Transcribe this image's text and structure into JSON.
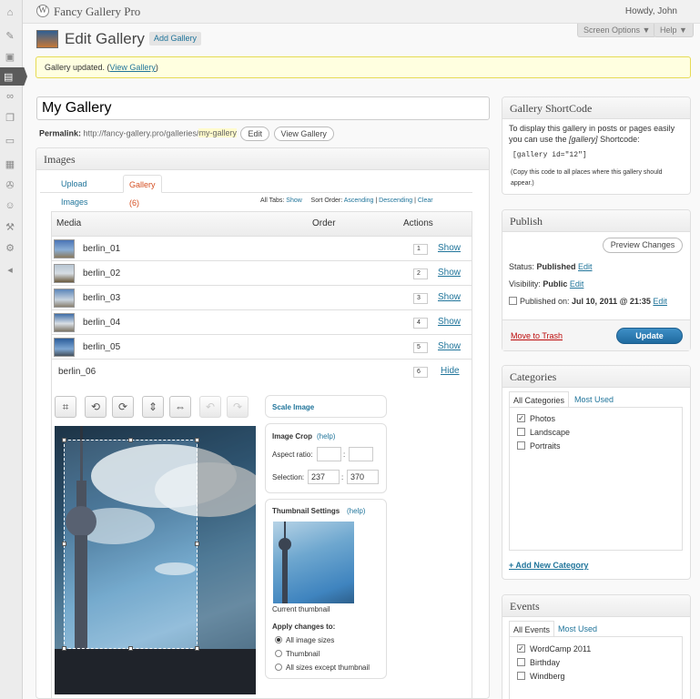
{
  "header": {
    "site_name": "Fancy Gallery Pro",
    "greeting": "Howdy, John",
    "wp_logo": "W"
  },
  "page": {
    "title": "Edit Gallery",
    "add_button": "Add Gallery",
    "screen_options": "Screen Options ▼",
    "help": "Help ▼"
  },
  "notice": {
    "text": "Gallery updated. (",
    "link": "View Gallery",
    "close": ")"
  },
  "gallery": {
    "title": "My Gallery",
    "permalink_label": "Permalink:",
    "permalink_base": "http://fancy-gallery.pro/galleries/",
    "permalink_slug": "my-gallery",
    "edit_button": "Edit",
    "view_button": "View Gallery"
  },
  "images_box": {
    "title": "Images",
    "tabs": [
      {
        "label": "Upload Images"
      },
      {
        "label": "Gallery (6)"
      }
    ],
    "sort": {
      "all_tabs": "All Tabs:",
      "show": "Show",
      "sort_order": "Sort Order:",
      "ascending": "Ascending",
      "sep1": "|",
      "descending": "Descending",
      "sep2": "|",
      "clear": "Clear"
    },
    "columns": {
      "media": "Media",
      "order": "Order",
      "actions": "Actions"
    },
    "rows": [
      {
        "name": "berlin_01",
        "order": "1",
        "action": "Show"
      },
      {
        "name": "berlin_02",
        "order": "2",
        "action": "Show"
      },
      {
        "name": "berlin_03",
        "order": "3",
        "action": "Show"
      },
      {
        "name": "berlin_04",
        "order": "4",
        "action": "Show"
      },
      {
        "name": "berlin_05",
        "order": "5",
        "action": "Show"
      },
      {
        "name": "berlin_06",
        "order": "6",
        "action": "Hide"
      }
    ],
    "editor": {
      "scale_image": "Scale Image",
      "crop_title": "Image Crop",
      "help": "(help)",
      "aspect_ratio": "Aspect ratio:",
      "colon": ":",
      "selection": "Selection:",
      "selection_w": "237",
      "selection_h": "370",
      "thumb_title": "Thumbnail Settings",
      "current_thumbnail": "Current thumbnail",
      "apply_title": "Apply changes to:",
      "options": [
        "All image sizes",
        "Thumbnail",
        "All sizes except thumbnail"
      ]
    }
  },
  "shortcode_box": {
    "title": "Gallery ShortCode",
    "line1": "To display this gallery in posts or pages easily",
    "line2a": "you can use the ",
    "line2em": "[gallery]",
    "line2b": " Shortcode:",
    "code": "[gallery id=\"12\"]",
    "note1": "(Copy this code to all places where this gallery should",
    "note2": "appear.)"
  },
  "publish_box": {
    "title": "Publish",
    "preview": "Preview Changes",
    "status_label": "Status: ",
    "status_value": "Published",
    "visibility_label": "Visibility: ",
    "visibility_value": "Public",
    "published_label": "Published on: ",
    "published_value": "Jul 10, 2011 @ 21:35",
    "edit": "Edit",
    "trash": "Move to Trash",
    "update": "Update"
  },
  "categories_box": {
    "title": "Categories",
    "tab_all": "All Categories",
    "tab_used": "Most Used",
    "items": [
      {
        "label": "Photos",
        "checked": true
      },
      {
        "label": "Landscape",
        "checked": false
      },
      {
        "label": "Portraits",
        "checked": false
      }
    ],
    "add_new": "+ Add New Category"
  },
  "events_box": {
    "title": "Events",
    "tab_all": "All Events",
    "tab_used": "Most Used",
    "items": [
      {
        "label": "WordCamp 2011",
        "checked": true
      },
      {
        "label": "Birthday",
        "checked": false
      },
      {
        "label": "Windberg",
        "checked": false
      }
    ]
  },
  "menu_icons": [
    "dashboard-icon",
    "posts-icon",
    "media-icon",
    "gallery-icon",
    "links-icon",
    "pages-icon",
    "comments-icon",
    "appearance-icon",
    "plugins-icon",
    "users-icon",
    "tools-icon",
    "settings-icon",
    "collapse-icon"
  ],
  "colors": {
    "link": "#21759b",
    "notice_bg": "#ffffe0",
    "primary": "#21759b",
    "trash": "#bc0b0b"
  }
}
